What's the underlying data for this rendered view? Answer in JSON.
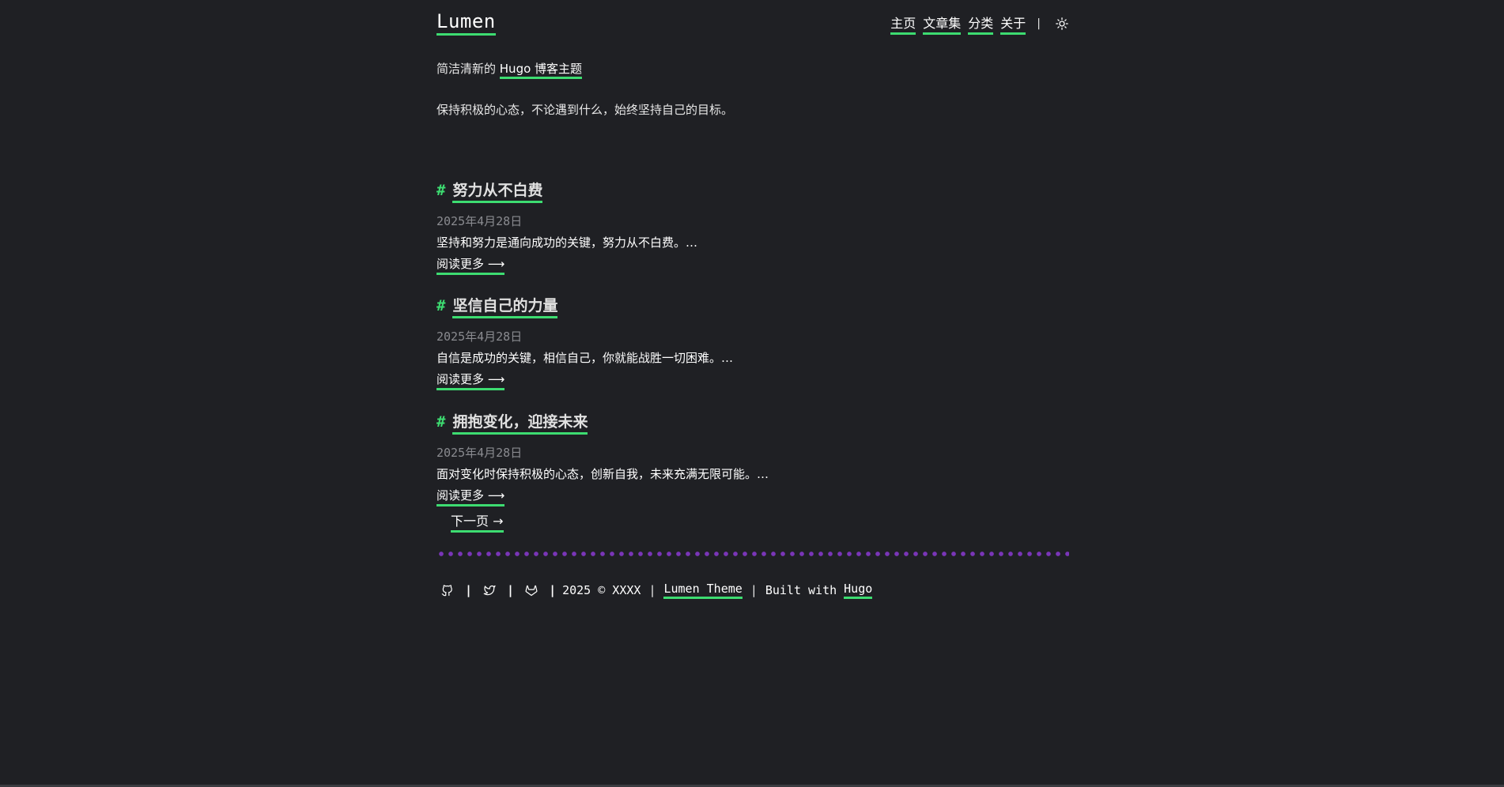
{
  "site": {
    "title": "Lumen"
  },
  "nav": {
    "items": [
      {
        "label": "主页"
      },
      {
        "label": "文章集"
      },
      {
        "label": "分类"
      },
      {
        "label": "关于"
      }
    ],
    "separator": "|",
    "theme_toggle_icon": "sun-icon"
  },
  "intro": {
    "prefix": "简洁清新的 ",
    "link": "Hugo 博客主题",
    "motto": "保持积极的心态，不论遇到什么，始终坚持自己的目标。"
  },
  "posts": [
    {
      "hash": "#",
      "title": "努力从不白费",
      "date": "2025年4月28日",
      "summary": "坚持和努力是通向成功的关键，努力从不白费。…",
      "read_more": "阅读更多 ⟶"
    },
    {
      "hash": "#",
      "title": "坚信自己的力量",
      "date": "2025年4月28日",
      "summary": "自信是成功的关键，相信自己，你就能战胜一切困难。…",
      "read_more": "阅读更多 ⟶"
    },
    {
      "hash": "#",
      "title": "拥抱变化，迎接未来",
      "date": "2025年4月28日",
      "summary": "面对变化时保持积极的心态，创新自我，未来充满无限可能。…",
      "read_more": "阅读更多 ⟶"
    }
  ],
  "pagination": {
    "next": "下一页 →"
  },
  "footer": {
    "icons": [
      "github-icon",
      "twitter-icon",
      "gitlab-icon"
    ],
    "copyright": "2025 © XXXX",
    "separator": "|",
    "theme_link": "Lumen Theme",
    "built_with": "Built with",
    "hugo_link": "Hugo"
  },
  "colors": {
    "background": "#1f2024",
    "accent": "#3ddc71",
    "divider": "#7a35b8",
    "muted": "#8a8b90"
  }
}
